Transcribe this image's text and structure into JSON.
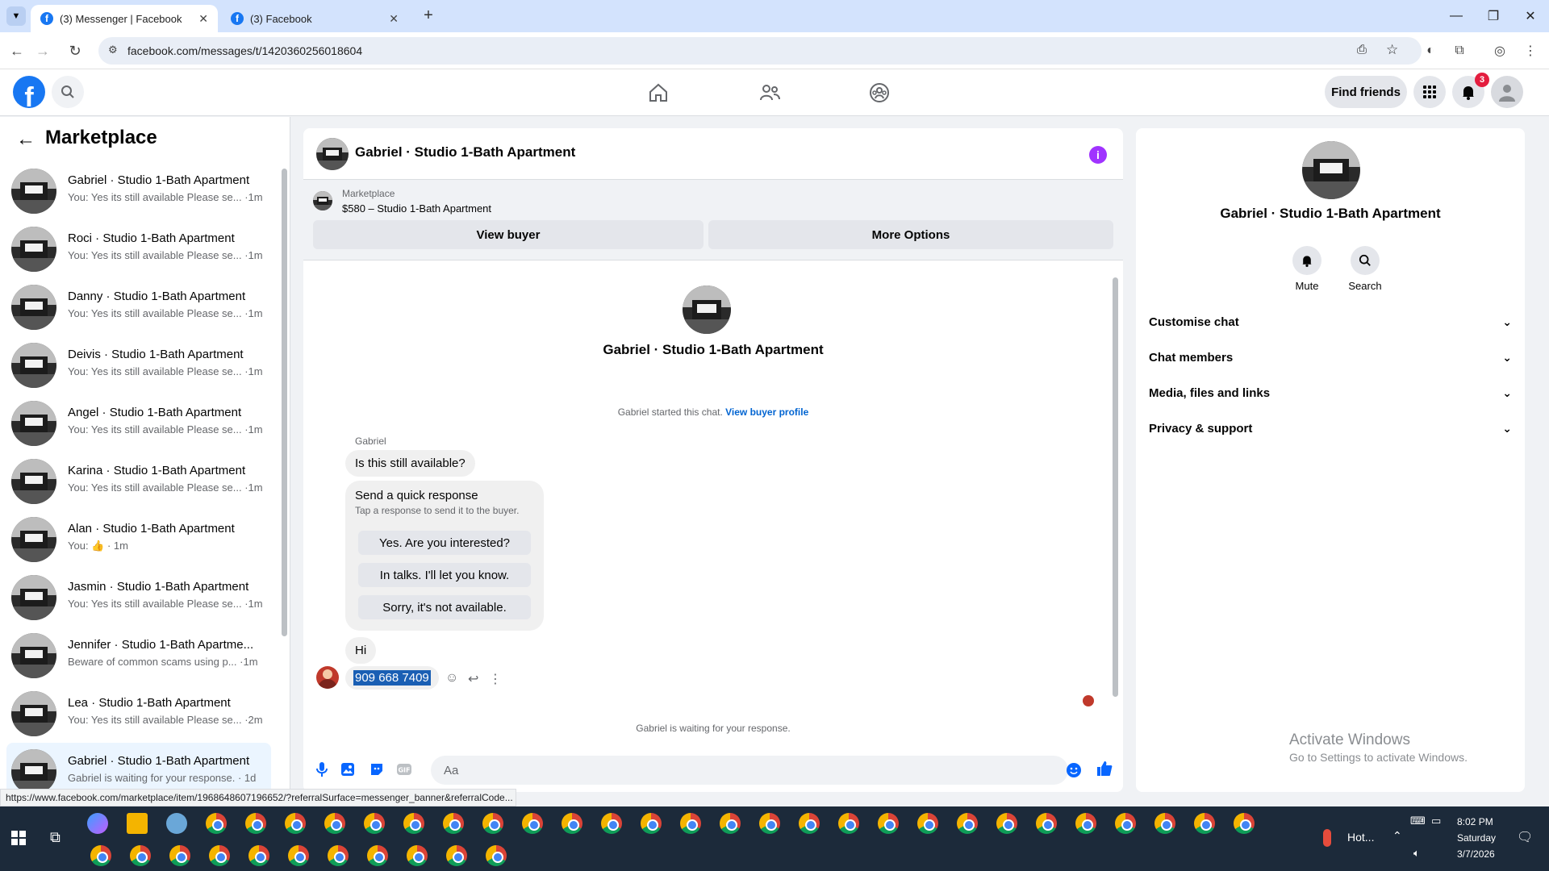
{
  "browser": {
    "tabs": [
      {
        "title": "(3) Messenger | Facebook"
      },
      {
        "title": "(3) Facebook"
      }
    ],
    "url": "facebook.com/messages/t/1420360256018604",
    "status_url": "https://www.facebook.com/marketplace/item/1968648607196652/?referralSurface=messenger_banner&referralCode..."
  },
  "header": {
    "find_friends": "Find friends",
    "notification_count": "3"
  },
  "sidebar": {
    "title": "Marketplace",
    "chats": [
      {
        "name": "Gabriel · Studio 1-Bath Apartment",
        "preview": "You: Yes its still available Please se... ·1m"
      },
      {
        "name": "Roci · Studio 1-Bath Apartment",
        "preview": "You: Yes its still available Please se... ·1m"
      },
      {
        "name": "Danny · Studio 1-Bath Apartment",
        "preview": "You: Yes its still available Please se... ·1m"
      },
      {
        "name": "Deivis · Studio 1-Bath Apartment",
        "preview": "You: Yes its still available Please se... ·1m"
      },
      {
        "name": "Angel · Studio 1-Bath Apartment",
        "preview": "You: Yes its still available Please se... ·1m"
      },
      {
        "name": "Karina · Studio 1-Bath Apartment",
        "preview": "You: Yes its still available Please se... ·1m"
      },
      {
        "name": "Alan · Studio 1-Bath Apartment",
        "preview": "You: 👍 · 1m"
      },
      {
        "name": "Jasmin · Studio 1-Bath Apartment",
        "preview": "You: Yes its still available Please se... ·1m"
      },
      {
        "name": "Jennifer · Studio 1-Bath Apartme...",
        "preview": "Beware of common scams using p... ·1m"
      },
      {
        "name": "Lea · Studio 1-Bath Apartment",
        "preview": "You: Yes its still available Please se... ·2m"
      },
      {
        "name": "Gabriel · Studio 1-Bath Apartment",
        "preview": "Gabriel is waiting for your response. · 1d"
      }
    ]
  },
  "chat": {
    "title": "Gabriel · Studio 1-Bath Apartment",
    "banner_label": "Marketplace",
    "banner_price": "$580 – Studio 1-Bath Apartment",
    "view_buyer": "View buyer",
    "more_options": "More Options",
    "center_name": "Gabriel · Studio 1-Bath Apartment",
    "started_text": "Gabriel started this chat.",
    "view_profile": "View buyer profile",
    "sender_name": "Gabriel",
    "msg1": "Is this still available?",
    "quick_title": "Send a quick response",
    "quick_sub": "Tap a response to send it to the buyer.",
    "quick_options": [
      "Yes. Are you interested?",
      "In talks. I'll let you know.",
      "Sorry, it's not available."
    ],
    "msg2": "Hi",
    "msg3": "909 668 7409",
    "waiting": "Gabriel is waiting for your response.",
    "input_placeholder": "Aa"
  },
  "info_panel": {
    "name": "Gabriel · Studio 1-Bath Apartment",
    "mute": "Mute",
    "search": "Search",
    "sections": [
      "Customise chat",
      "Chat members",
      "Media, files and links",
      "Privacy & support"
    ]
  },
  "windows": {
    "activate_title": "Activate Windows",
    "activate_sub": "Go to Settings to activate Windows.",
    "weather": "Hot...",
    "time": "8:02 PM",
    "day": "Saturday",
    "date": "3/7/2026"
  },
  "colors": {
    "fb_blue": "#1877f2",
    "messenger_blue": "#0866ff",
    "info_purple": "#a033ff"
  }
}
